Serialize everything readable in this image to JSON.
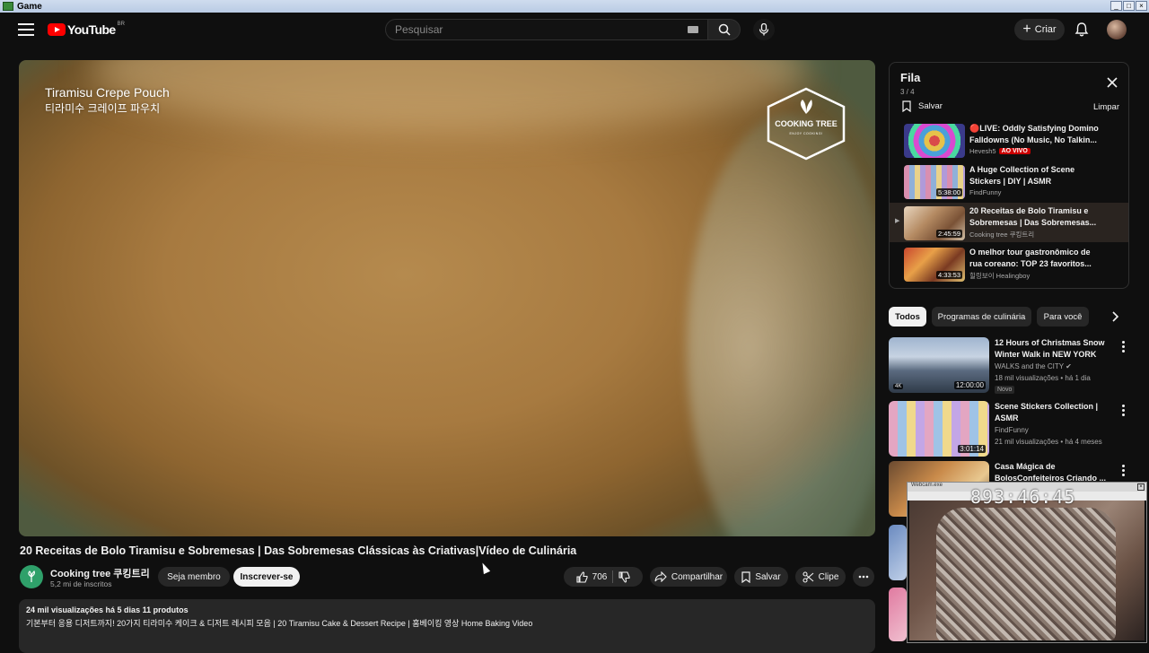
{
  "os_window": {
    "title": "Game"
  },
  "header": {
    "logo_text": "YouTube",
    "logo_country": "BR",
    "search_placeholder": "Pesquisar",
    "create_label": "Criar"
  },
  "player": {
    "overlay_title_en": "Tiramisu Crepe Pouch",
    "overlay_title_ko": "티라미수 크레이프 파우치",
    "watermark_name": "COOKING TREE",
    "watermark_sub": "ENJOY COOKING!"
  },
  "video": {
    "title": "20 Receitas de Bolo Tiramisu e Sobremesas | Das Sobremesas Clássicas às Criativas|Vídeo de Culinária",
    "channel": "Cooking tree 쿠킹트리",
    "subscribers": "5,2 mi de inscritos",
    "join_label": "Seja membro",
    "subscribe_label": "Inscrever-se",
    "likes": "706",
    "share_label": "Compartilhar",
    "save_label": "Salvar",
    "clip_label": "Clipe",
    "description_stats": "24 mil visualizações  há 5 dias  11 produtos",
    "description_text": "기본부터 응용 디저트까지! 20가지 티라미수 케이크 & 디저트 레시피 모음 | 20 Tiramisu Cake & Dessert Recipe | 홈베이킹 영상 Home Baking Video"
  },
  "queue": {
    "title": "Fila",
    "count": "3 / 4",
    "save_label": "Salvar",
    "clear_label": "Limpar",
    "items": [
      {
        "title": "🔴LIVE: Oddly Satisfying Domino Falldowns (No Music, No Talkin...",
        "channel": "Hevesh5",
        "badge": "AO VIVO",
        "duration": ""
      },
      {
        "title": "A Huge Collection of Scene Stickers | DIY | ASMR",
        "channel": "FindFunny",
        "badge": "",
        "duration": "5:38:00"
      },
      {
        "title": "20 Receitas de Bolo Tiramisu e Sobremesas | Das Sobremesas...",
        "channel": "Cooking tree 쿠킹트리",
        "badge": "",
        "duration": "2:45:59"
      },
      {
        "title": "O melhor tour gastronômico de rua coreano: TOP 23 favoritos...",
        "channel": "힐링보이 Healingboy",
        "badge": "",
        "duration": "4:33:53"
      }
    ]
  },
  "chips": [
    "Todos",
    "Programas de culinária",
    "Para você"
  ],
  "recommendations": [
    {
      "title": "12 Hours of Christmas Snow Winter Walk in NEW YORK",
      "channel": "WALKS and the CITY ✔",
      "stats": "18 mil visualizações • há 1 dia",
      "duration": "12:00:00",
      "badge": "Novo",
      "quality": "4K"
    },
    {
      "title": "Scene Stickers Collection | ASMR",
      "channel": "FindFunny",
      "stats": "21 mil visualizações • há 4 meses",
      "duration": "3:01:14",
      "badge": "",
      "quality": ""
    },
    {
      "title": "Casa Mágica de BolosConfeiteiros Criando ...",
      "channel": "",
      "stats": "",
      "duration": "",
      "badge": "",
      "quality": ""
    }
  ],
  "webcam": {
    "title": "Webcam.exe",
    "clock": "893:46:45"
  }
}
